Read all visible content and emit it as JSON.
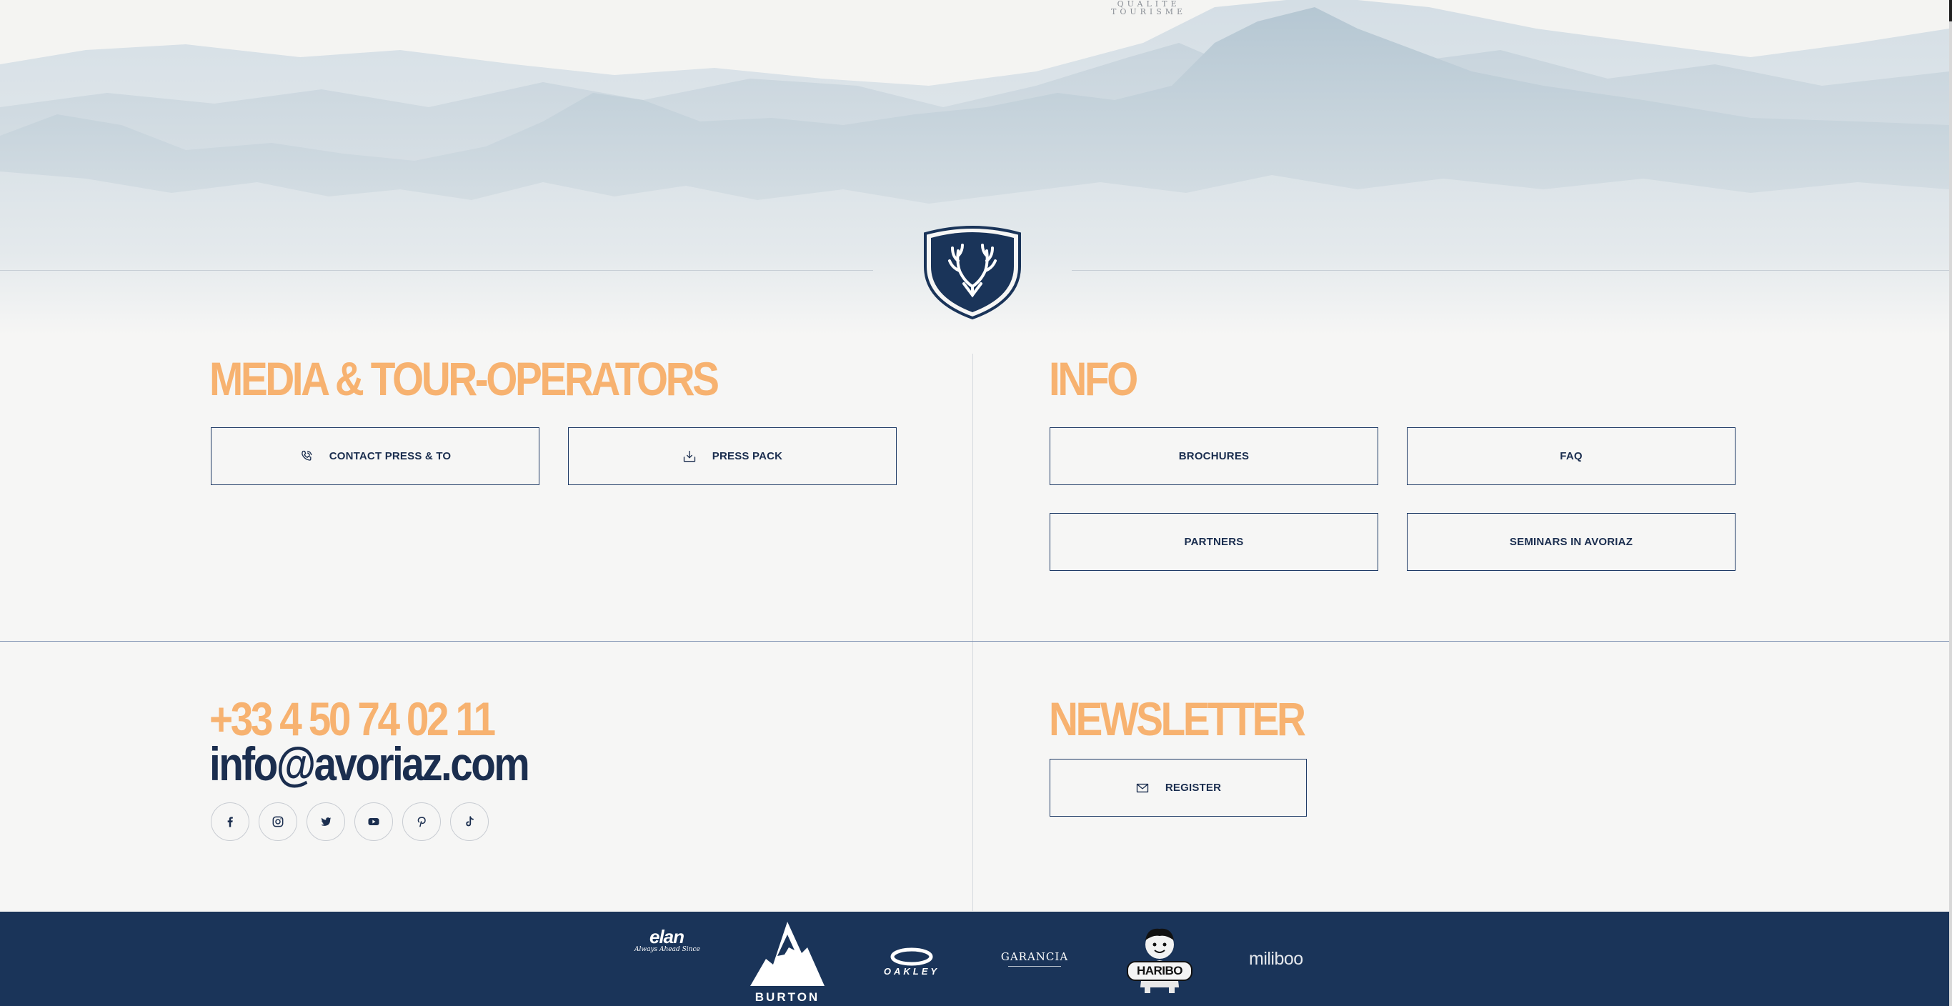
{
  "header": {
    "badge_line1": "QUALITÉ",
    "badge_line2": "TOURISME"
  },
  "media_section": {
    "heading": "MEDIA & TOUR-OPERATORS",
    "contact_label": "CONTACT PRESS & TO",
    "presspack_label": "PRESS PACK"
  },
  "info_section": {
    "heading": "INFO",
    "brochures_label": "BROCHURES",
    "faq_label": "FAQ",
    "partners_label": "PARTNERS",
    "seminars_label": "SEMINARS IN AVORIAZ"
  },
  "contact": {
    "phone": "+33 4 50 74 02 11",
    "email": "info@avoriaz.com"
  },
  "social_icons": [
    "facebook-icon",
    "instagram-icon",
    "twitter-icon",
    "youtube-icon",
    "pinterest-icon",
    "tiktok-icon"
  ],
  "newsletter": {
    "heading": "NEWSLETTER",
    "register_label": "REGISTER"
  },
  "partners": {
    "elan": "elan",
    "elan_tagline": "Always Ahead Since",
    "burton": "BURTON",
    "oakley": "OAKLEY",
    "garancia": "GARANCIA",
    "haribo": "HARIBO",
    "miliboo": "miliboo"
  },
  "colors": {
    "accent": "#f7b270",
    "navy": "#1a3459",
    "background": "#f6f6f5"
  }
}
